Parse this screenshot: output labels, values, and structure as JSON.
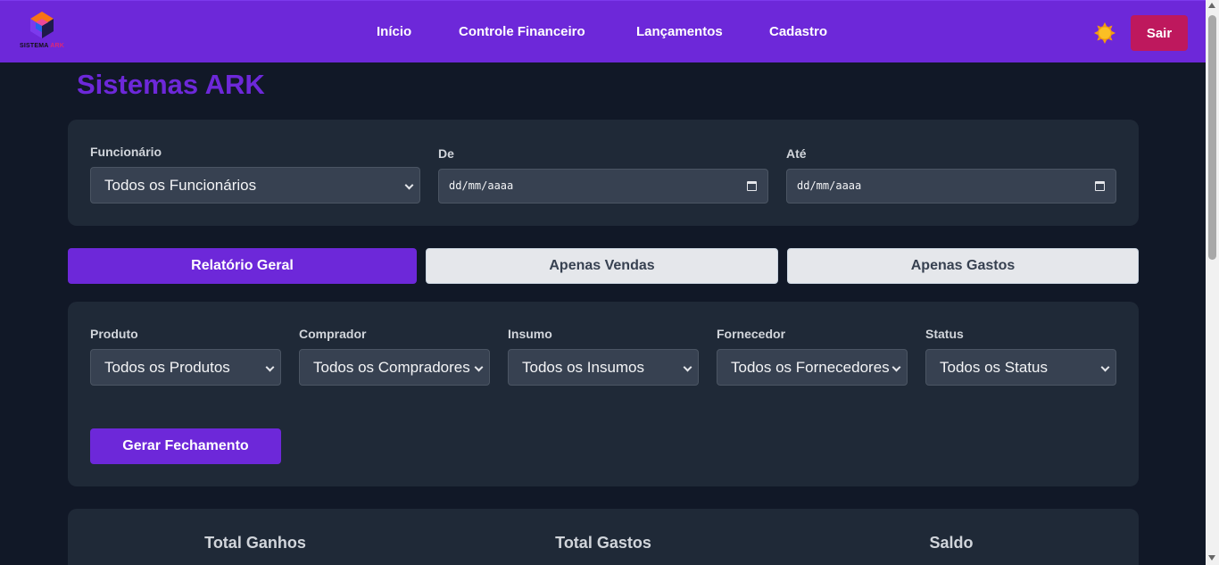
{
  "app": {
    "logo_text_main": "SISTEMA",
    "logo_text_accent": "ARK",
    "page_title": "Sistemas ARK"
  },
  "nav": {
    "items": [
      {
        "label": "Início"
      },
      {
        "label": "Controle Financeiro"
      },
      {
        "label": "Lançamentos"
      },
      {
        "label": "Cadastro"
      }
    ],
    "theme_toggle_icon": "sun-icon",
    "logout_label": "Sair"
  },
  "filters": {
    "employee_label": "Funcionário",
    "employee_value": "Todos os Funcionários",
    "from_label": "De",
    "from_placeholder": "dd/mm/aaaa",
    "to_label": "Até",
    "to_placeholder": "dd/mm/aaaa"
  },
  "tabs": [
    {
      "label": "Relatório Geral",
      "active": true
    },
    {
      "label": "Apenas Vendas",
      "active": false
    },
    {
      "label": "Apenas Gastos",
      "active": false
    }
  ],
  "report_filters": {
    "fields": [
      {
        "label": "Produto",
        "value": "Todos os Produtos"
      },
      {
        "label": "Comprador",
        "value": "Todos os Compradores"
      },
      {
        "label": "Insumo",
        "value": "Todos os Insumos"
      },
      {
        "label": "Fornecedor",
        "value": "Todos os Fornecedores"
      },
      {
        "label": "Status",
        "value": "Todos os Status"
      }
    ],
    "generate_label": "Gerar Fechamento"
  },
  "summary": {
    "total_earnings_label": "Total Ganhos",
    "total_expenses_label": "Total Gastos",
    "balance_label": "Saldo"
  },
  "colors": {
    "primary": "#6d28d9",
    "logout": "#be185d",
    "background": "#111827",
    "card": "#1f2937",
    "input": "#374151"
  }
}
